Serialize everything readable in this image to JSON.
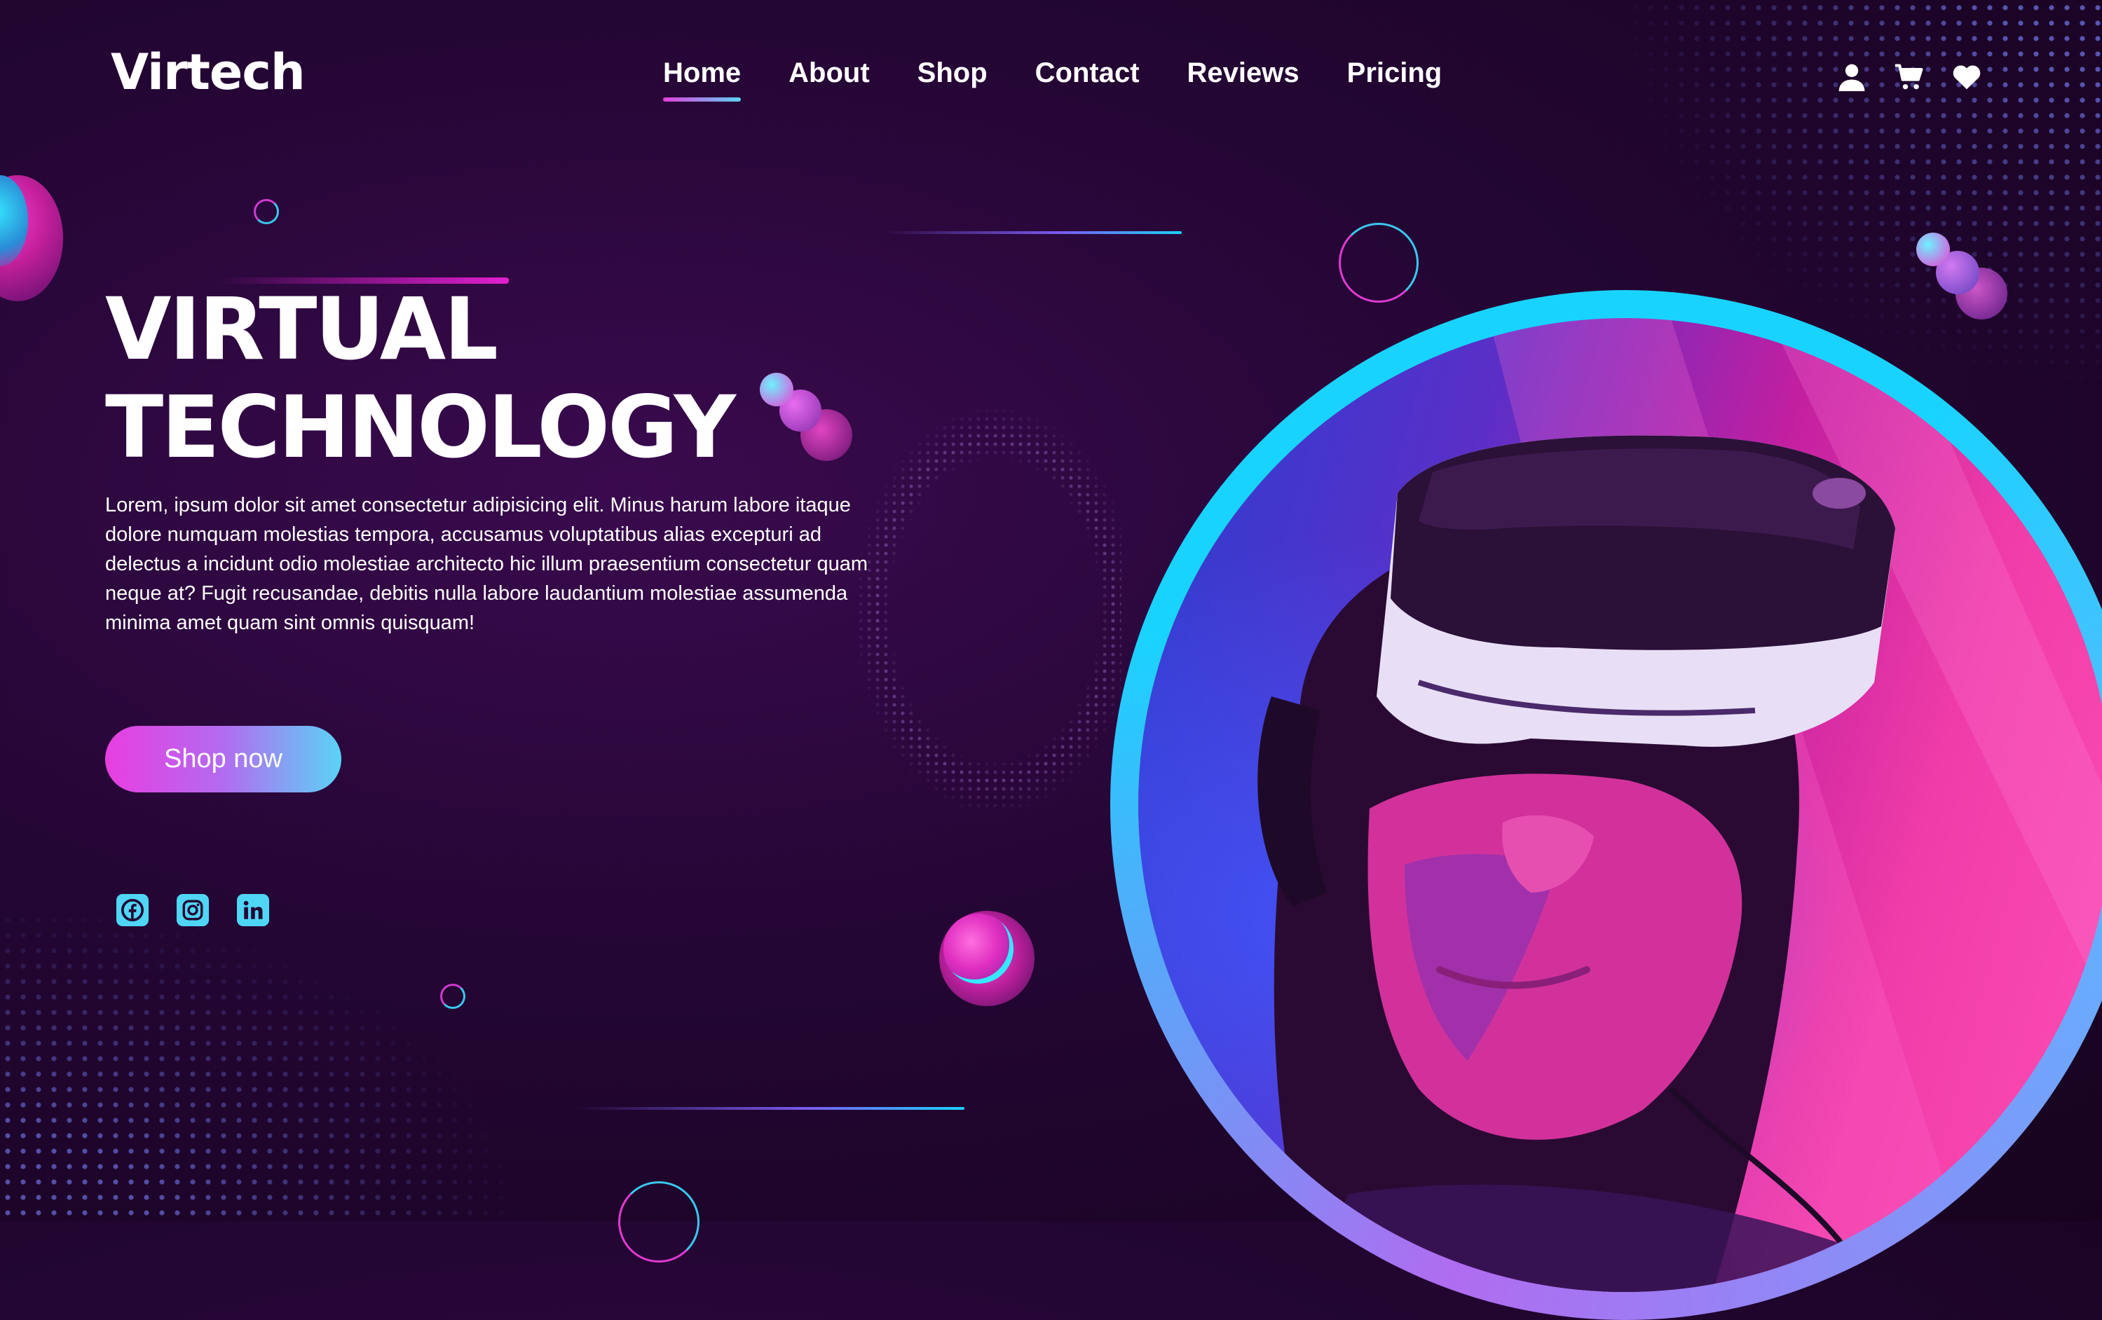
{
  "brand": {
    "name": "Virtech"
  },
  "nav": {
    "items": [
      {
        "label": "Home",
        "active": true
      },
      {
        "label": "About",
        "active": false
      },
      {
        "label": "Shop",
        "active": false
      },
      {
        "label": "Contact",
        "active": false
      },
      {
        "label": "Reviews",
        "active": false
      },
      {
        "label": "Pricing",
        "active": false
      }
    ]
  },
  "header_icons": [
    "user-icon",
    "cart-icon",
    "heart-icon"
  ],
  "hero": {
    "title_line1": "VIRTUAL",
    "title_line2": "TECHNOLOGY",
    "description": "Lorem, ipsum dolor sit amet consectetur adipisicing elit. Minus harum labore itaque dolore numquam molestias tempora, accusamus voluptatibus alias excepturi ad delectus a incidunt odio molestiae architecto hic illum praesentium consectetur quam neque at? Fugit recusandae, debitis nulla labore laudantium molestiae assumenda minima amet quam sint omnis quisquam!",
    "cta_label": "Shop now",
    "image_alt": "person wearing VR headset"
  },
  "socials": [
    "facebook-icon",
    "instagram-icon",
    "linkedin-icon"
  ],
  "colors": {
    "background": "#240634",
    "accent_pink": "#e83ee0",
    "accent_cyan": "#19d3ff",
    "social_icon_bg": "#4fd6f5"
  }
}
